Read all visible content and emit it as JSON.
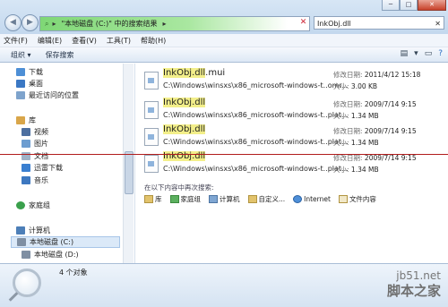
{
  "window": {
    "controls": [
      "─",
      "□",
      "✕"
    ]
  },
  "address": {
    "segments": [
      "▸",
      "\"本地磁盘 (C:)\" 中的搜索结果",
      "▸"
    ],
    "search_value": "InkObj.dll"
  },
  "menu": [
    "文件(F)",
    "编辑(E)",
    "查看(V)",
    "工具(T)",
    "帮助(H)"
  ],
  "toolbar": {
    "organize": "组织 ▾",
    "save_search": "保存搜索"
  },
  "nav": {
    "items": [
      {
        "label": "下载",
        "color": "#4d8fd6"
      },
      {
        "label": "桌面",
        "color": "#3b78c4"
      },
      {
        "label": "最近访问的位置",
        "color": "#7ea3cc"
      },
      {
        "label": "库",
        "color": "#d9a64a"
      },
      {
        "label": "视频",
        "color": "#4c6fa0"
      },
      {
        "label": "图片",
        "color": "#6d9dd0"
      },
      {
        "label": "文档",
        "color": "#9fb2c8"
      },
      {
        "label": "迅雷下载",
        "color": "#3a7fd0"
      },
      {
        "label": "音乐",
        "color": "#3d78c0"
      },
      {
        "label": "家庭组",
        "color": "#3aa04c"
      },
      {
        "label": "计算机",
        "color": "#4d7fb8"
      },
      {
        "label": "本地磁盘 (C:)",
        "color": "#7f8fa3"
      },
      {
        "label": "本地磁盘 (D:)",
        "color": "#7f8fa3"
      }
    ]
  },
  "results": [
    {
      "name": "InkObj.dll.mui",
      "highlight": "InkObj.dll",
      "rest": ".mui",
      "path": "C:\\Windows\\winsxs\\x86_microsoft-windows-t..omr...",
      "date_label": "修改日期:",
      "date": "2011/4/12 15:18",
      "size_label": "大小:",
      "size": "3.00 KB"
    },
    {
      "name": "InkObj.dll",
      "highlight": "InkObj.dll",
      "rest": "",
      "path": "C:\\Windows\\winsxs\\x86_microsoft-windows-t..plat...",
      "date_label": "修改日期:",
      "date": "2009/7/14 9:15",
      "size_label": "大小:",
      "size": "1.34 MB"
    },
    {
      "name": "InkObj.dll",
      "highlight": "InkObj.dll",
      "rest": "",
      "path": "C:\\Windows\\winsxs\\x86_microsoft-windows-t..plat...",
      "date_label": "修改日期:",
      "date": "2009/7/14 9:15",
      "size_label": "大小:",
      "size": "1.34 MB"
    },
    {
      "name": "InkObj.dll",
      "highlight": "InkObj.dll",
      "rest": "",
      "path": "C:\\Windows\\winsxs\\x86_microsoft-windows-t..plat...",
      "date_label": "修改日期:",
      "date": "2009/7/14 9:15",
      "size_label": "大小:",
      "size": "1.34 MB"
    }
  ],
  "search_again": {
    "label": "在以下内容中再次搜索:",
    "locations": [
      "库",
      "家庭组",
      "计算机",
      "自定义...",
      "Internet",
      "文件内容"
    ]
  },
  "status": {
    "count": "4 个对象"
  },
  "watermark": {
    "line1": "jb51.net",
    "line2": "脚本之家"
  }
}
